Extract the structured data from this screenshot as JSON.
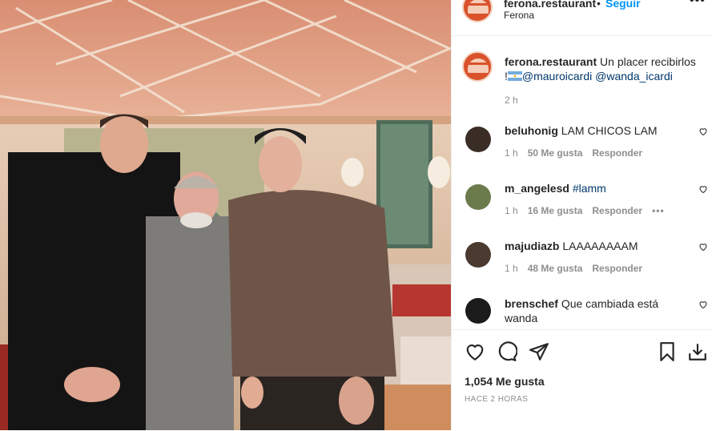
{
  "post": {
    "username": "ferona.restaurant",
    "follow_label": "Seguir",
    "separator": "•",
    "location": "Ferona",
    "more_label": "•••"
  },
  "caption": {
    "username": "ferona.restaurant",
    "text": "Un placer recibirlos",
    "line2_prefix": "!",
    "mention1": "@mauroicardi",
    "mention2": "@wanda_icardi",
    "time": "2 h"
  },
  "comments": [
    {
      "username": "beluhonig",
      "text": "LAM CHICOS LAM",
      "time": "1 h",
      "likes": "50 Me gusta",
      "reply": "Responder",
      "avatar_color": "#3a2d26"
    },
    {
      "username": "m_angelesd",
      "text": "#lamm",
      "time": "1 h",
      "likes": "16 Me gusta",
      "reply": "Responder",
      "more": "•••",
      "avatar_color": "#6b7b4c"
    },
    {
      "username": "majudiazb",
      "text": "LAAAAAAAAM",
      "time": "1 h",
      "likes": "48 Me gusta",
      "reply": "Responder",
      "avatar_color": "#4a3a30"
    },
    {
      "username": "brenschef",
      "text": "Que cambiada está",
      "text2": "wanda",
      "avatar_color": "#1b1b1b"
    }
  ],
  "footer": {
    "likes": "1,054 Me gusta",
    "ago": "HACE 2 HORAS"
  },
  "colors": {
    "link": "#0095f6",
    "mention": "#00376b",
    "brand": "#d9522b"
  }
}
